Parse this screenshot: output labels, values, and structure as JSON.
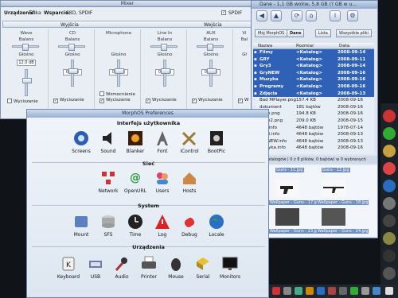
{
  "mixer": {
    "title": "Mixer",
    "device_label": "Urządzenie:",
    "device_value": "Efika",
    "support_label": "Wsparcie:",
    "support_value": "S3D, SPDIF",
    "spdif_label": "SPDIF",
    "tab_outputs": "Wyjścia",
    "tab_inputs": "Wejścia",
    "channels": [
      {
        "name": "Wave",
        "balance": "Balans",
        "volume": "Głośno",
        "db": "12.0 dB",
        "mute": "Wyciszanie",
        "muted": false
      },
      {
        "name": "CD",
        "balance": "Balans",
        "volume": "Głośno",
        "db": "0.0 dB",
        "mute": "Wyciszanie",
        "muted": true
      },
      {
        "name": "Microphone",
        "balance": "",
        "volume": "Głośno",
        "db": "0.0 dB",
        "mute": "Wyciszanie",
        "boost": "Wzmocnienie",
        "muted": true
      },
      {
        "name": "Line In",
        "balance": "Balans",
        "volume": "Głośno",
        "db": "0.0 dB",
        "mute": "Wyciszanie",
        "muted": true
      },
      {
        "name": "AUX",
        "balance": "Balans",
        "volume": "Głośno",
        "db": "0.0 dB",
        "mute": "Wyciszanie",
        "muted": true
      },
      {
        "name": "Vi",
        "balance": "Bal",
        "volume": "Gł",
        "db": "",
        "mute": "W",
        "muted": true
      }
    ]
  },
  "dir": {
    "title": "Dane - 1,1 GB wolne, 5,8 GB (? GB w u...",
    "btn_morphos": "Mój MorphOS",
    "btn_dane": "Dane",
    "btn_list": "Lista",
    "btn_all": "Wszystkie pliki",
    "col_name": "Nazwa",
    "col_size": "Rozmiar",
    "col_date": "Data",
    "rows": [
      {
        "name": "Filmy",
        "size": "<Katalog>",
        "date": "2008-09-14",
        "dir": true
      },
      {
        "name": "GRY",
        "size": "<Katalog>",
        "date": "2008-09-11",
        "dir": true
      },
      {
        "name": "Gry3",
        "size": "<Katalog>",
        "date": "2008-09-14",
        "dir": true
      },
      {
        "name": "GryNEW",
        "size": "<Katalog>",
        "date": "2008-09-16",
        "dir": true
      },
      {
        "name": "Muzyka",
        "size": "<Katalog>",
        "date": "2008-09-16",
        "dir": true
      },
      {
        "name": "Programy",
        "size": "<Katalog>",
        "date": "2008-09-16",
        "dir": true
      },
      {
        "name": "Zdjęcia",
        "size": "<Katalog>",
        "date": "2008-09-13",
        "dir": true
      },
      {
        "name": "Bad MPlayer.png",
        "size": "157.4 KB",
        "date": "2008-09-16",
        "dir": false
      },
      {
        "name": "dokument",
        "size": "181 bajtów",
        "date": "2008-09-16",
        "dir": false
      },
      {
        "name": "Grab.png",
        "size": "194.8 KB",
        "date": "2008-09-16",
        "dir": false
      },
      {
        "name": "Grab2.png",
        "size": "209.0 KB",
        "date": "2008-09-15",
        "dir": false
      },
      {
        "name": "GRY.info",
        "size": "4648 bajtów",
        "date": "1978-07-14",
        "dir": false
      },
      {
        "name": "Gry3.info",
        "size": "4648 bajtów",
        "date": "2008-09-13",
        "dir": false
      },
      {
        "name": "GryNEW.info",
        "size": "4648 bajtów",
        "date": "2008-09-13",
        "dir": false
      },
      {
        "name": "Muzyka.info",
        "size": "4648 bajtów",
        "date": "2008-09-16",
        "dir": false
      }
    ],
    "status": "0 z 8 katalogów | 0 z 8 plików, 0 bajtów) w 0 wybranych",
    "thumbs": [
      "Guns - 11.jpg",
      "Guns - 12.jpg",
      "Wallpaper - Guns - 17.jpg",
      "Wallpaper - Guns - 18.jpg",
      "Wallpaper - Guns - 23.jpg",
      "Wallpaper - Guns - 24.jpg"
    ]
  },
  "prefs": {
    "title": "MorphOS Preferences",
    "section1": "Interfejs użytkownika",
    "section2": "Sieć",
    "section3": "System",
    "section4": "Urządzenia",
    "ui_items": [
      "Screens",
      "Sound",
      "Blanker",
      "Font",
      "iControl",
      "BootPic"
    ],
    "net_items": [
      "Network",
      "OpenURL",
      "Users",
      "Hosts"
    ],
    "sys_items": [
      "Mount",
      "SFS",
      "Time",
      "Log",
      "Debug",
      "Locale"
    ],
    "dev_items": [
      "Keyboard",
      "USB",
      "Audio",
      "Printer",
      "Mouse",
      "Serial",
      "Monitors"
    ]
  }
}
